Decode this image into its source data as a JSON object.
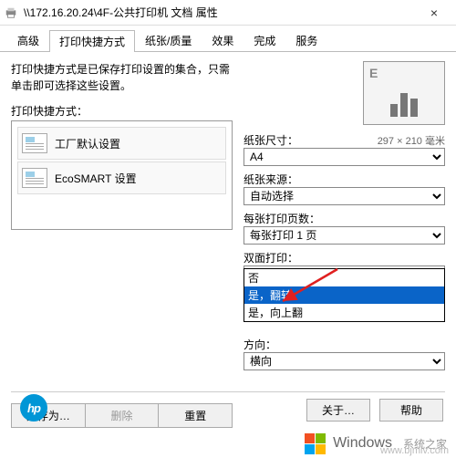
{
  "window": {
    "title": "\\\\172.16.20.24\\4F-公共打印机 文档 属性",
    "close": "×"
  },
  "tabs": {
    "t0": "高级",
    "t1": "打印快捷方式",
    "t2": "纸张/质量",
    "t3": "效果",
    "t4": "完成",
    "t5": "服务"
  },
  "description": "打印快捷方式是已保存打印设置的集合，只需单击即可选择这些设置。",
  "shortcut_header": "打印快捷方式：",
  "shortcuts": {
    "s0": "工厂默认设置",
    "s1": "EcoSMART 设置"
  },
  "left_buttons": {
    "save_as": "另存为…",
    "delete": "删除",
    "reset": "重置"
  },
  "preview_letter": "E",
  "fields": {
    "paper_size": {
      "label": "纸张尺寸：",
      "dim": "297 × 210 毫米",
      "value": "A4"
    },
    "paper_source": {
      "label": "纸张来源：",
      "value": "自动选择"
    },
    "pages_per_sheet": {
      "label": "每张打印页数：",
      "value": "每张打印 1 页"
    },
    "duplex": {
      "label": "双面打印：",
      "value": "否",
      "options": {
        "o0": "否",
        "o1": "是，翻转",
        "o2": "是，向上翻"
      }
    },
    "orientation": {
      "label": "方向：",
      "value": "横向"
    }
  },
  "footer": {
    "about": "关于…",
    "help": "帮助"
  },
  "logo": "hp",
  "watermark": {
    "brand": "Windows",
    "sub": "系统之家",
    "url": "www.bjmlv.com"
  }
}
